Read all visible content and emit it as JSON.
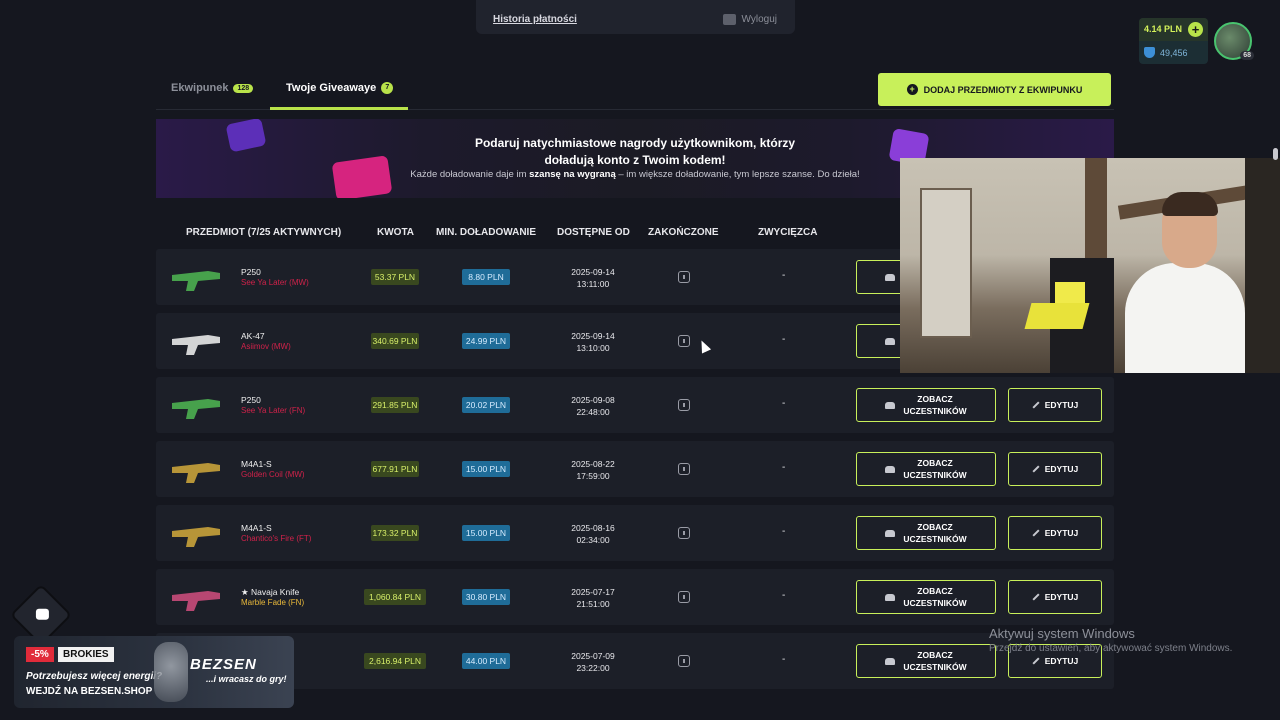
{
  "top_menu": {
    "history": "Historia płatności",
    "logout": "Wyloguj"
  },
  "wallet": {
    "balance": "4.14 PLN",
    "points": "49,456",
    "level": "68"
  },
  "tabs": [
    {
      "label": "Ekwipunek",
      "count": "128"
    },
    {
      "label": "Twoje Giveawaye",
      "count": "7"
    }
  ],
  "add_button": "DODAJ PRZEDMIOTY Z EKWIPUNKU",
  "banner": {
    "line1": "Podaruj natychmiastowe nagrody użytkownikom, którzy",
    "line2": "doładują konto z Twoim kodem!",
    "sub_pre": "Każde doładowanie daje im ",
    "sub_bold": "szansę na wygraną",
    "sub_post": " – im większe doładowanie, tym lepsze szanse. Do dzieła!"
  },
  "table_headers": {
    "item": "PRZEDMIOT (7/25 AKTYWNYCH)",
    "amount": "KWOTA",
    "min_topup": "MIN. DOŁADOWANIE",
    "available_from": "DOSTĘPNE OD",
    "ended": "ZAKOŃCZONE",
    "winner": "ZWYCIĘZCA"
  },
  "buttons": {
    "participants_1": "ZOBACZ",
    "participants_2": "UCZESTNIKÓW",
    "edit": "EDYTUJ"
  },
  "rows": [
    {
      "name": "P250",
      "skin": "See Ya Later (MW)",
      "amount": "53.37 PLN",
      "min": "8.80 PLN",
      "date": "2025-09-14",
      "time": "13:11:00",
      "winner": "-"
    },
    {
      "name": "AK-47",
      "skin": "Asiimov (MW)",
      "amount": "340.69 PLN",
      "min": "24.99 PLN",
      "date": "2025-09-14",
      "time": "13:10:00",
      "winner": "-"
    },
    {
      "name": "P250",
      "skin": "See Ya Later (FN)",
      "amount": "291.85 PLN",
      "min": "20.02 PLN",
      "date": "2025-09-08",
      "time": "22:48:00",
      "winner": "-"
    },
    {
      "name": "M4A1-S",
      "skin": "Golden Coil (MW)",
      "amount": "677.91 PLN",
      "min": "15.00 PLN",
      "date": "2025-08-22",
      "time": "17:59:00",
      "winner": "-"
    },
    {
      "name": "M4A1-S",
      "skin": "Chantico's Fire (FT)",
      "amount": "173.32 PLN",
      "min": "15.00 PLN",
      "date": "2025-08-16",
      "time": "02:34:00",
      "winner": "-"
    },
    {
      "name": "★ Navaja Knife",
      "skin": "Marble Fade (FN)",
      "amount": "1,060.84 PLN",
      "min": "30.80 PLN",
      "date": "2025-07-17",
      "time": "21:51:00",
      "winner": "-"
    },
    {
      "name": "nife",
      "skin": "ase 3 (FN)",
      "amount": "2,616.94 PLN",
      "min": "44.00 PLN",
      "date": "2025-07-09",
      "time": "23:22:00",
      "winner": "-"
    }
  ],
  "ad": {
    "discount": "-5%",
    "brand": "BROKIES",
    "line1": "Potrzebujesz więcej energii?",
    "line2": "WEJDŹ NA BEZSEN.SHOP",
    "logo": "BEZSEN",
    "tagline": "...i wracasz do gry!"
  },
  "watermark": {
    "title": "Aktywuj system Windows",
    "subtitle": "Przejdź do ustawień, aby aktywować system Windows."
  },
  "colors": {
    "accent": "#c8f05a",
    "background": "#15171f",
    "row": "#1c1f28",
    "amount_bg": "#39481f",
    "min_bg": "#1f6c98",
    "skin_red": "#d0224a",
    "skin_gold": "#e8b83a"
  },
  "icons": [
    "plus-icon",
    "shield-icon",
    "people-icon",
    "pencil-icon",
    "info-icon",
    "chat-icon",
    "logout-icon"
  ]
}
